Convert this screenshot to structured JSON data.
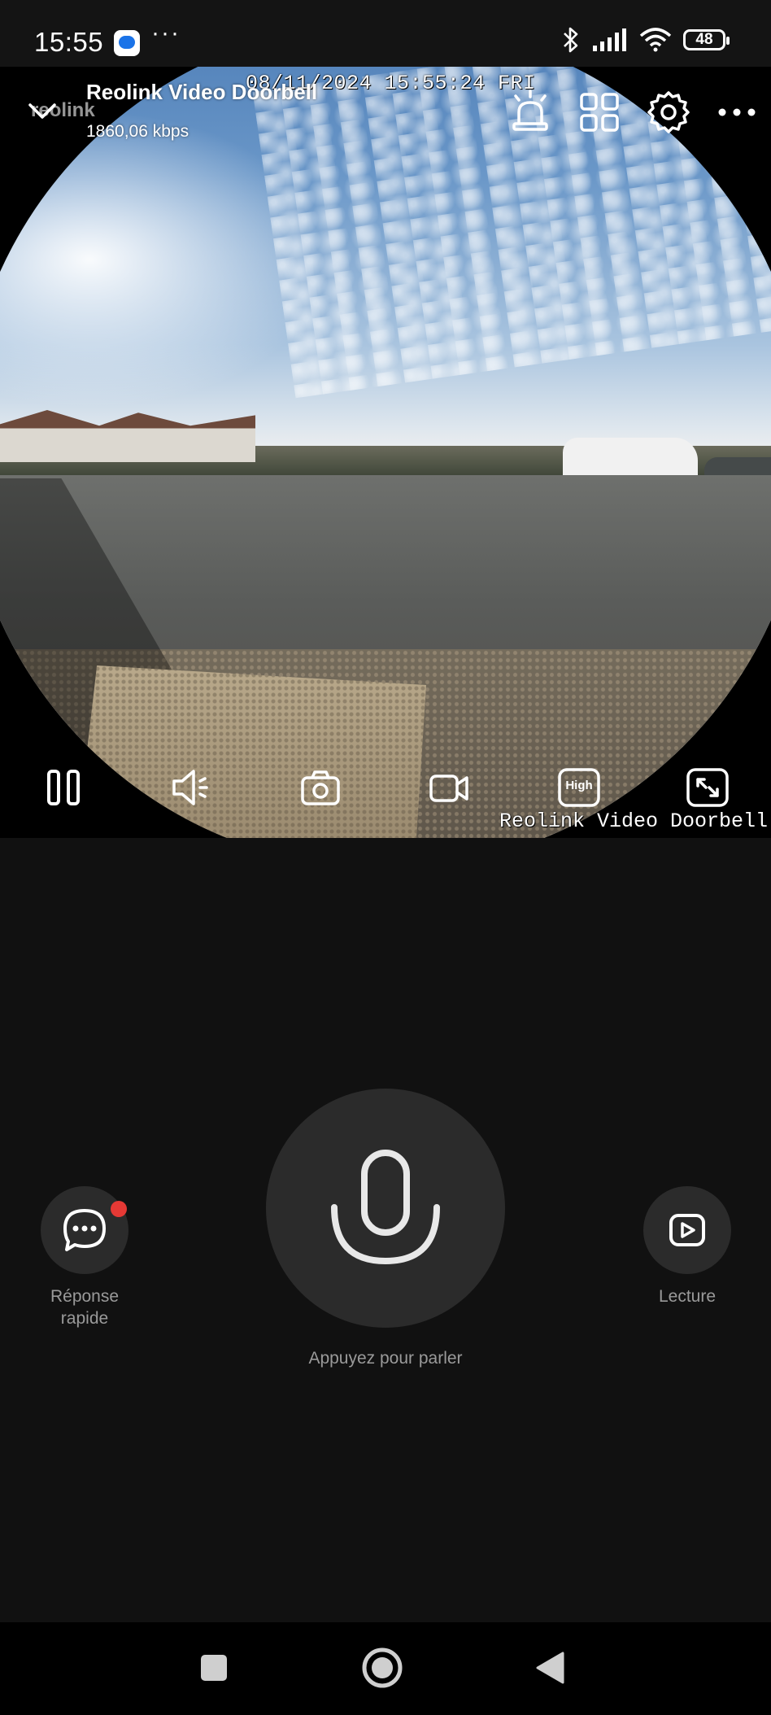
{
  "status_bar": {
    "time": "15:55",
    "more": "···",
    "battery": "48"
  },
  "camera": {
    "title": "Reolink Video Doorbell",
    "bitrate": "1860,06 kbps",
    "osd_datetime": "08/11/2024 15:55:24 FRI",
    "osd_name": "Reolink Video Doorbell",
    "watermark": "reolink"
  },
  "controls": {
    "quality_badge": "High"
  },
  "talk": {
    "label": "Appuyez pour parler"
  },
  "quick_reply": {
    "label_line1": "Réponse",
    "label_line2": "rapide"
  },
  "playback": {
    "label": "Lecture"
  },
  "colors": {
    "background": "#111111",
    "button_bg": "#2b2b2b",
    "notification_dot": "#e53935",
    "muted_text": "#9a9a9a"
  }
}
